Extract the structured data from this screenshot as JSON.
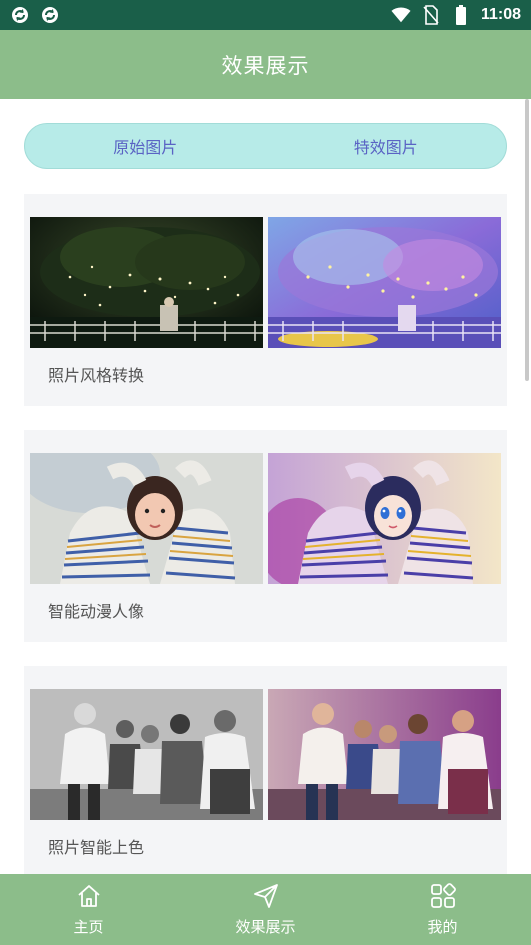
{
  "status_bar": {
    "time": "11:08",
    "left_icons": [
      "sync-icon",
      "sync-icon"
    ],
    "right_icons": [
      "wifi-icon",
      "no-sim-icon",
      "battery-icon"
    ]
  },
  "header": {
    "title": "效果展示"
  },
  "toggle": {
    "original_label": "原始图片",
    "effect_label": "特效图片"
  },
  "cards": [
    {
      "label": "照片风格转换"
    },
    {
      "label": "智能动漫人像"
    },
    {
      "label": "照片智能上色"
    }
  ],
  "bottom_nav": [
    {
      "label": "主页",
      "icon": "home-icon"
    },
    {
      "label": "效果展示",
      "icon": "send-icon"
    },
    {
      "label": "我的",
      "icon": "grid-icon"
    }
  ],
  "colors": {
    "status_bar": "#1a5f49",
    "header": "#8cbd8a",
    "toggle_bg": "#b7ebe8",
    "toggle_text": "#5a63c4",
    "card_bg": "#f4f5f7"
  }
}
